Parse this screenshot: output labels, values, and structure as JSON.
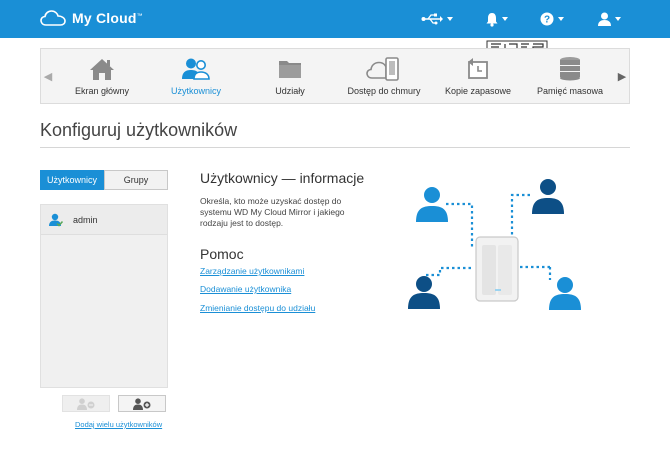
{
  "app": {
    "logo_text": "My Cloud",
    "logo_tm": "™"
  },
  "topbar": {
    "icons": [
      "usb-icon",
      "bell-icon",
      "help-icon",
      "user-icon"
    ]
  },
  "nav": {
    "items": [
      {
        "label": "Ekran główny",
        "icon": "home-icon"
      },
      {
        "label": "Użytkownicy",
        "icon": "users-icon",
        "active": true
      },
      {
        "label": "Udziały",
        "icon": "folder-icon"
      },
      {
        "label": "Dostęp do chmury",
        "icon": "cloud-device-icon"
      },
      {
        "label": "Kopie zapasowe",
        "icon": "backup-icon"
      },
      {
        "label": "Pamięć masowa",
        "icon": "storage-icon"
      }
    ]
  },
  "page": {
    "title": "Konfiguruj użytkowników"
  },
  "left": {
    "tabs": [
      {
        "label": "Użytkownicy",
        "active": true
      },
      {
        "label": "Grupy",
        "active": false
      }
    ],
    "users": [
      {
        "name": "admin"
      }
    ],
    "add_multiple_link": "Dodaj wielu użytkowników"
  },
  "info": {
    "title": "Użytkownicy — informacje",
    "text": "Określa, kto może uzyskać dostęp do systemu WD My Cloud Mirror i jakiego rodzaju jest to dostęp.",
    "help_title": "Pomoc",
    "links": [
      "Zarządzanie użytkownikami",
      "Dodawanie użytkownika",
      "Zmienianie dostępu do udziału"
    ]
  },
  "colors": {
    "brand_blue": "#1a8fd6",
    "navy": "#0d4f86"
  }
}
